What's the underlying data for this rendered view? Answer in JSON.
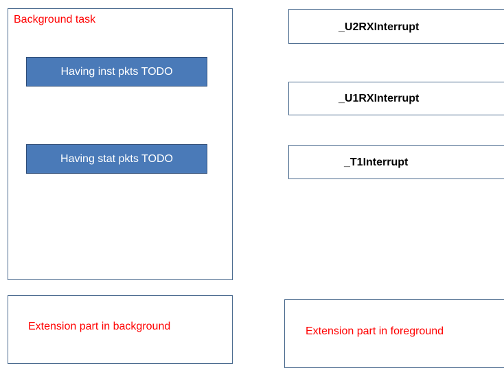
{
  "background_task": {
    "title": "Background task",
    "items": [
      {
        "label": "Having inst pkts TODO"
      },
      {
        "label": "Having stat pkts TODO"
      }
    ]
  },
  "interrupts": [
    {
      "label": "_U2RXInterrupt"
    },
    {
      "label": "_U1RXInterrupt"
    },
    {
      "label": "_T1Interrupt"
    }
  ],
  "extensions": {
    "background": "Extension part in background",
    "foreground": "Extension part in foreground"
  },
  "colors": {
    "title_red": "#ff0000",
    "button_blue": "#4a7ab8",
    "border": "#4a6a8e"
  }
}
